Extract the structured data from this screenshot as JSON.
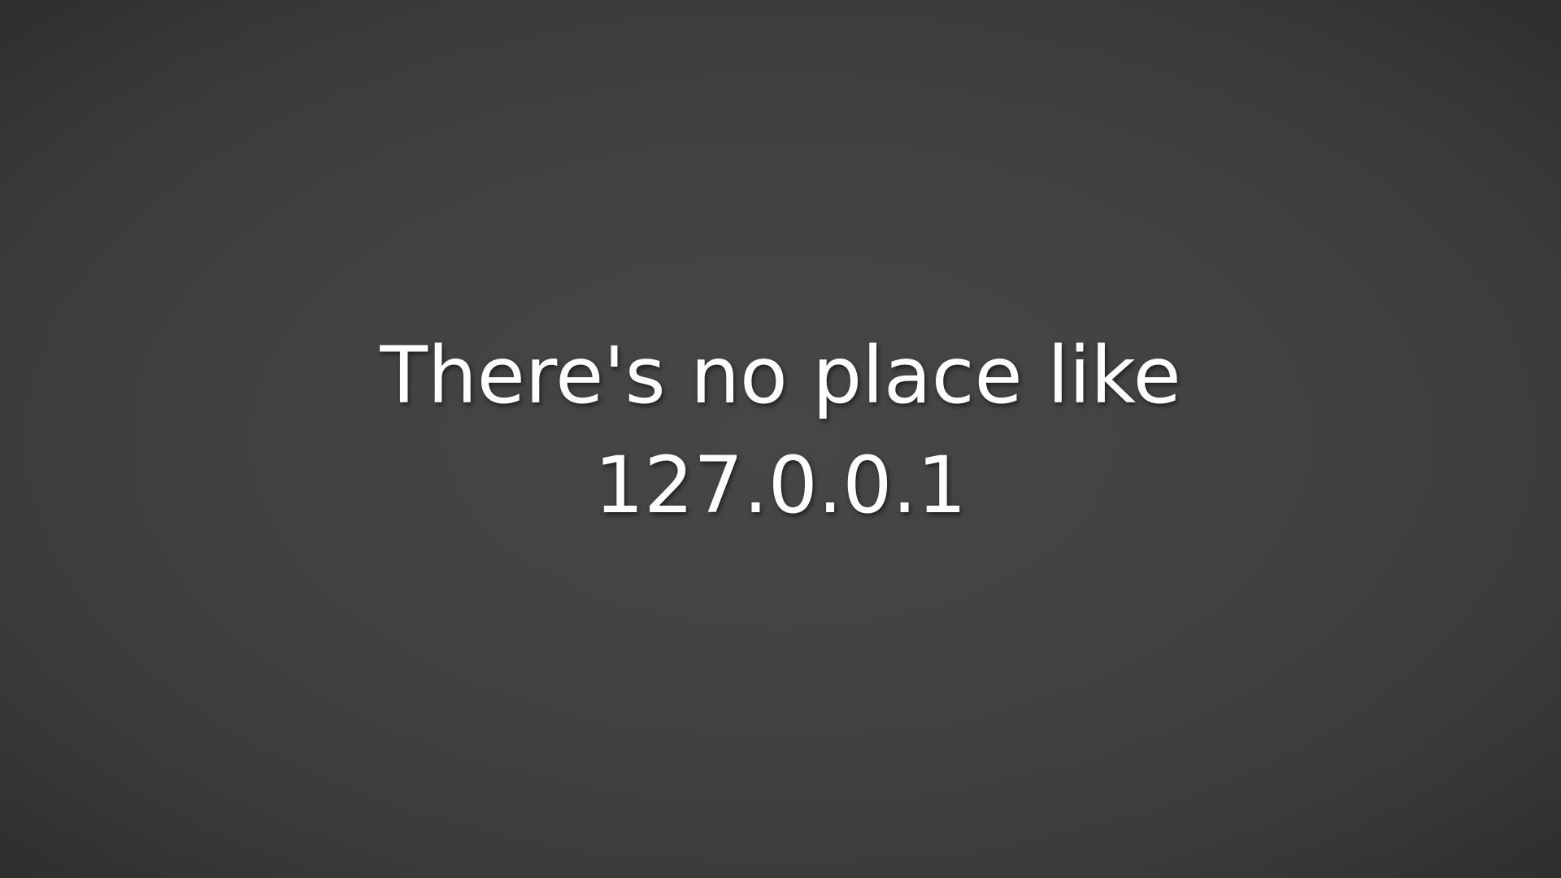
{
  "wallpaper": {
    "line1": "There's no place like",
    "line2": "127.0.0.1",
    "text_color": "#ffffff",
    "background_color": "#434343"
  }
}
